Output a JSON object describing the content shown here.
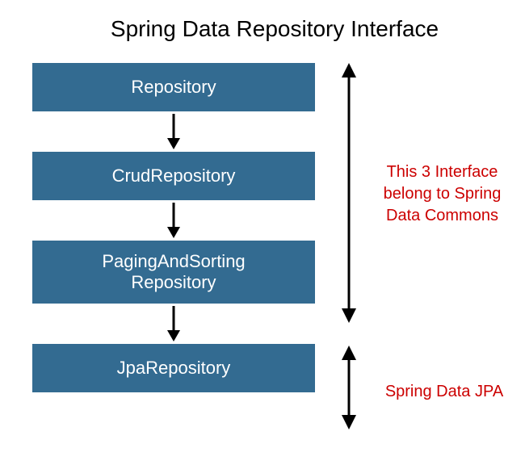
{
  "title": "Spring Data Repository Interface",
  "boxes": {
    "b1": "Repository",
    "b2": "CrudRepository",
    "b3_line1": "PagingAndSorting",
    "b3_line2": "Repository",
    "b4": "JpaRepository"
  },
  "annotations": {
    "a1_line1": "This 3 Interface",
    "a1_line2": "belong to Spring",
    "a1_line3": "Data Commons",
    "a2": "Spring Data JPA"
  },
  "colors": {
    "box_bg": "#336b91",
    "box_text": "#ffffff",
    "annotation_text": "#cc0000"
  }
}
